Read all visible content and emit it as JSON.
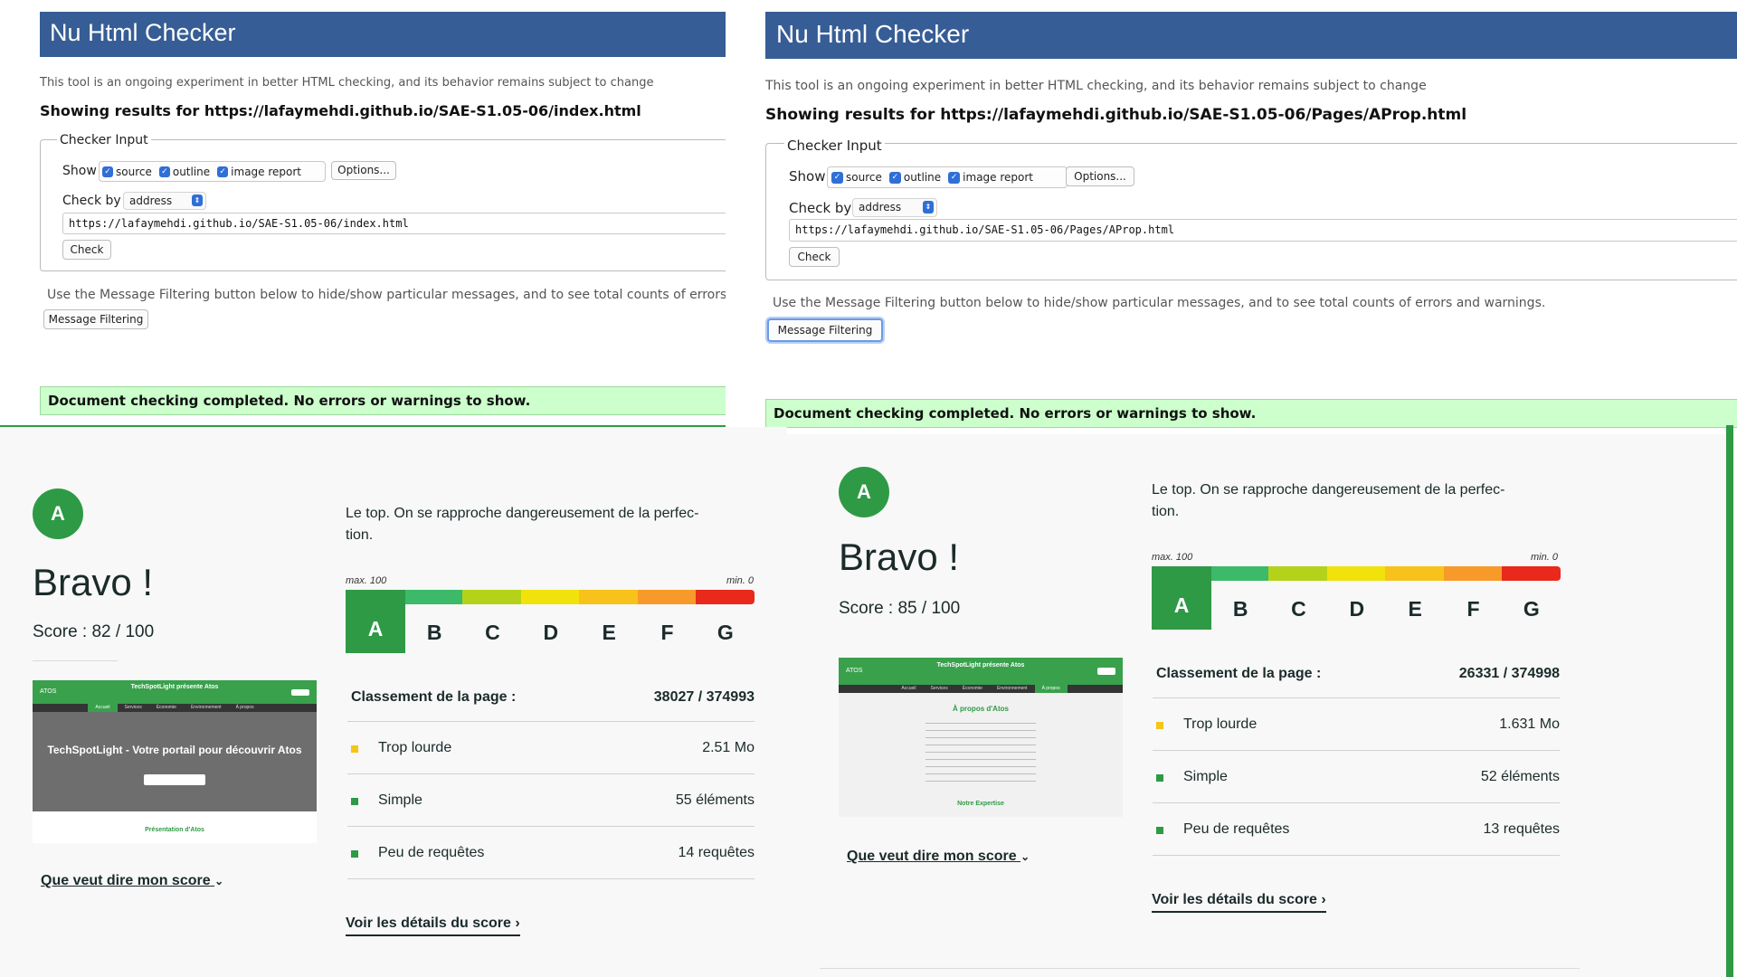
{
  "checker_left": {
    "title": "Nu Html Checker",
    "intro": "This tool is an ongoing experiment in better HTML checking, and its behavior remains subject to change",
    "showing": "Showing results for https://lafaymehdi.github.io/SAE-S1.05-06/index.html",
    "legend": "Checker Input",
    "show_label": "Show",
    "opt_source": "source",
    "opt_outline": "outline",
    "opt_image": "image report",
    "options_button": "Options...",
    "checkby_label": "Check by",
    "checkby_value": "address",
    "url": "https://lafaymehdi.github.io/SAE-S1.05-06/index.html",
    "check_button": "Check",
    "filter_text": "Use the Message Filtering button below to hide/show particular messages, and to see total counts of errors and wa",
    "filter_button": "Message Filtering",
    "result": "Document checking completed. No errors or warnings to show."
  },
  "checker_right": {
    "title": "Nu Html Checker",
    "intro": "This tool is an ongoing experiment in better HTML checking, and its behavior remains subject to change",
    "showing": "Showing results for https://lafaymehdi.github.io/SAE-S1.05-06/Pages/AProp.html",
    "legend": "Checker Input",
    "show_label": "Show",
    "opt_source": "source",
    "opt_outline": "outline",
    "opt_image": "image report",
    "options_button": "Options...",
    "checkby_label": "Check by",
    "checkby_value": "address",
    "url": "https://lafaymehdi.github.io/SAE-S1.05-06/Pages/AProp.html",
    "check_button": "Check",
    "filter_text": "Use the Message Filtering button below to hide/show particular messages, and to see total counts of errors and warnings.",
    "filter_button": "Message Filtering",
    "result": "Document checking completed. No errors or warnings to show."
  },
  "eco_left": {
    "grade": "A",
    "bravo": "Bravo !",
    "score": "Score : 82 / 100",
    "description": "Le top. On se rapproche dangereusement de la perfec-tion.",
    "scale_max": "max. 100",
    "scale_min": "min. 0",
    "grades": [
      "A",
      "B",
      "C",
      "D",
      "E",
      "F",
      "G"
    ],
    "rank_label": "Classement de la page :",
    "rank_value": "38027 / 374993",
    "metrics": [
      {
        "label": "Trop lourde",
        "value": "2.51 Mo",
        "color": "#f5c518"
      },
      {
        "label": "Simple",
        "value": "55 éléments",
        "color": "#2e9a45"
      },
      {
        "label": "Peu de requêtes",
        "value": "14 requêtes",
        "color": "#2e9a45"
      }
    ],
    "score_link": "Que veut dire mon score",
    "details_link": "Voir les détails du score",
    "thumb": {
      "logo": "ATOS",
      "header_title": "TechSpotLight présente Atos",
      "nav": [
        "Accueil",
        "Services",
        "Économie",
        "Environnement",
        "À propos"
      ],
      "hero_title": "TechSpotLight - Votre portail pour découvrir Atos",
      "section": "Présentation d'Atos"
    }
  },
  "eco_right": {
    "grade": "A",
    "bravo": "Bravo !",
    "score": "Score : 85 / 100",
    "description": "Le top. On se rapproche dangereusement de la perfec-tion.",
    "scale_max": "max. 100",
    "scale_min": "min. 0",
    "grades": [
      "A",
      "B",
      "C",
      "D",
      "E",
      "F",
      "G"
    ],
    "rank_label": "Classement de la page :",
    "rank_value": "26331 / 374998",
    "metrics": [
      {
        "label": "Trop lourde",
        "value": "1.631 Mo",
        "color": "#f5c518"
      },
      {
        "label": "Simple",
        "value": "52 éléments",
        "color": "#2e9a45"
      },
      {
        "label": "Peu de requêtes",
        "value": "13 requêtes",
        "color": "#2e9a45"
      }
    ],
    "score_link": "Que veut dire mon score",
    "details_link": "Voir les détails du score",
    "thumb": {
      "logo": "ATOS",
      "header_title": "TechSpotLight présente Atos",
      "nav": [
        "Accueil",
        "Services",
        "Économie",
        "Environnement",
        "À propos"
      ],
      "page_title": "À propos d'Atos",
      "section": "Notre Expertise"
    }
  },
  "colors": {
    "banner": "#365d95",
    "success_bg": "#ccffcc",
    "eco_green": "#2e9a45",
    "scale": [
      "#2e9a45",
      "#3cba6a",
      "#b5d21a",
      "#f2e20c",
      "#f7c21a",
      "#f79a2a",
      "#e8291c"
    ]
  }
}
